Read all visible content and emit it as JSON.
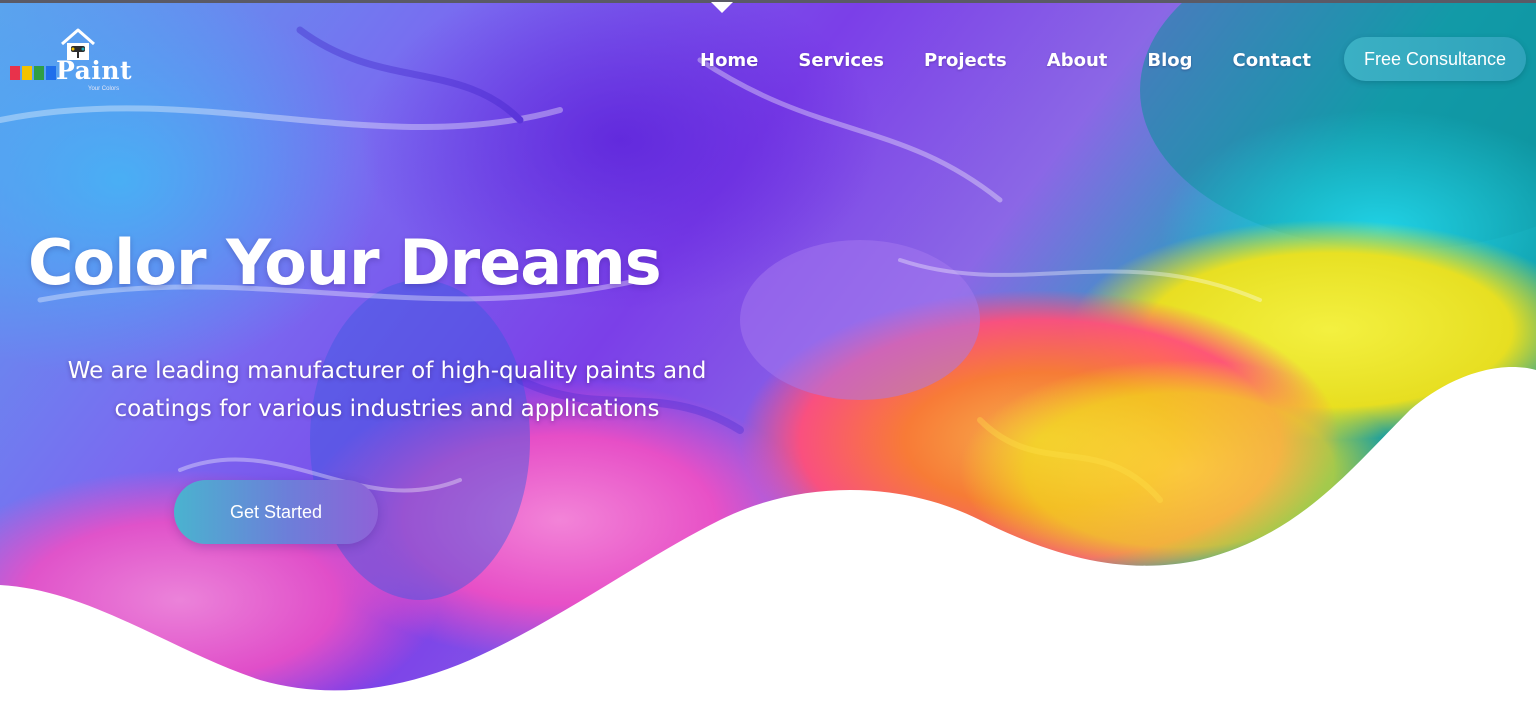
{
  "header": {
    "logo_text": "Paint",
    "logo_tagline": "Your Colors",
    "nav": [
      {
        "label": "Home"
      },
      {
        "label": "Services"
      },
      {
        "label": "Projects"
      },
      {
        "label": "About"
      },
      {
        "label": "Blog"
      },
      {
        "label": "Contact"
      }
    ],
    "cta_label": "Free Consultance"
  },
  "hero": {
    "title": "Color Your Dreams",
    "subtitle": "We are leading manufacturer of high-quality paints and coatings for various industries and applications",
    "cta_label": "Get Started"
  },
  "colors": {
    "accent_teal": "#2fa3bb",
    "accent_purple": "#8e62d8",
    "text_light": "#ffffff",
    "page_bg": "#ffffff"
  },
  "icons": {
    "logo": "house-with-paint-roller-icon"
  }
}
